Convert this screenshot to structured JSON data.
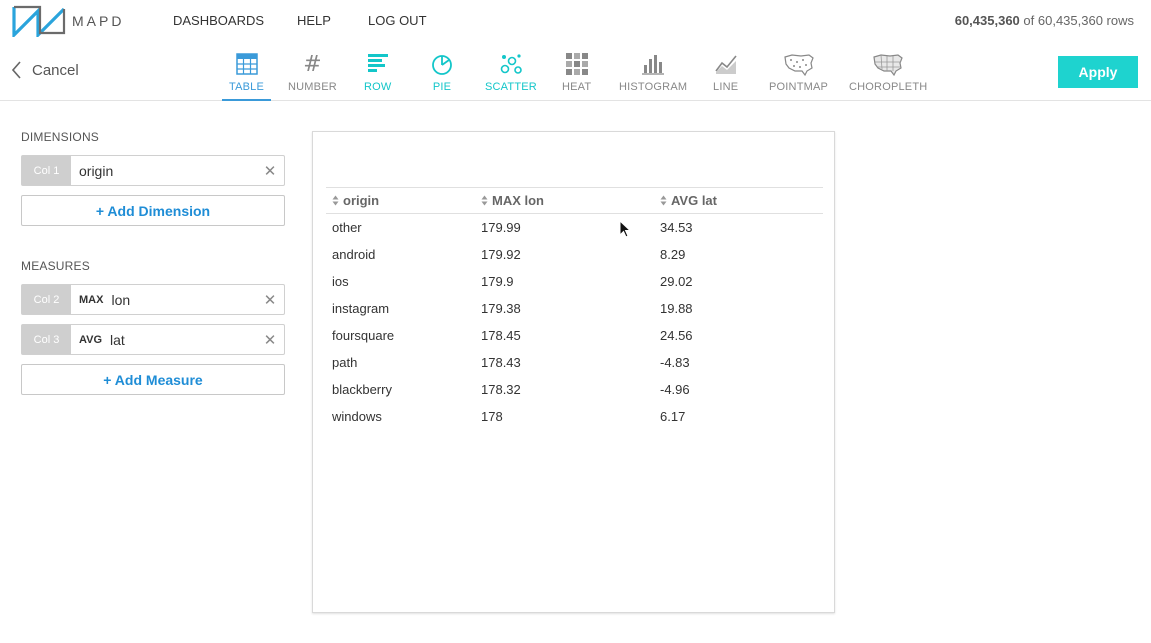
{
  "brand": {
    "name": "MAPD"
  },
  "nav": {
    "dashboards": "DASHBOARDS",
    "help": "HELP",
    "logout": "LOG OUT"
  },
  "rowcount": {
    "filtered": "60,435,360",
    "of_text": "of 60,435,360 rows"
  },
  "toolbar": {
    "cancel": "Cancel",
    "apply": "Apply",
    "chart_types": [
      "TABLE",
      "NUMBER",
      "ROW",
      "PIE",
      "SCATTER",
      "HEAT",
      "HISTOGRAM",
      "LINE",
      "POINTMAP",
      "CHOROPLETH"
    ],
    "selected": "TABLE"
  },
  "dimensions": {
    "title": "DIMENSIONS",
    "items": [
      {
        "col": "Col 1",
        "field": "origin"
      }
    ],
    "add_label": "+ Add Dimension"
  },
  "measures": {
    "title": "MEASURES",
    "items": [
      {
        "col": "Col 2",
        "agg": "MAX",
        "field": "lon"
      },
      {
        "col": "Col 3",
        "agg": "AVG",
        "field": "lat"
      }
    ],
    "add_label": "+ Add Measure"
  },
  "table": {
    "columns": [
      "origin",
      "MAX lon",
      "AVG lat"
    ],
    "rows": [
      [
        "other",
        "179.99",
        "34.53"
      ],
      [
        "android",
        "179.92",
        "8.29"
      ],
      [
        "ios",
        "179.9",
        "29.02"
      ],
      [
        "instagram",
        "179.38",
        "19.88"
      ],
      [
        "foursquare",
        "178.45",
        "24.56"
      ],
      [
        "path",
        "178.43",
        "-4.83"
      ],
      [
        "blackberry",
        "178.32",
        "-4.96"
      ],
      [
        "windows",
        "178",
        "6.17"
      ]
    ]
  },
  "colors": {
    "accent_teal": "#13c6c9",
    "accent_blue": "#3a9ad9",
    "apply_bg": "#1ed3cf",
    "link_blue": "#1f8dd6"
  }
}
